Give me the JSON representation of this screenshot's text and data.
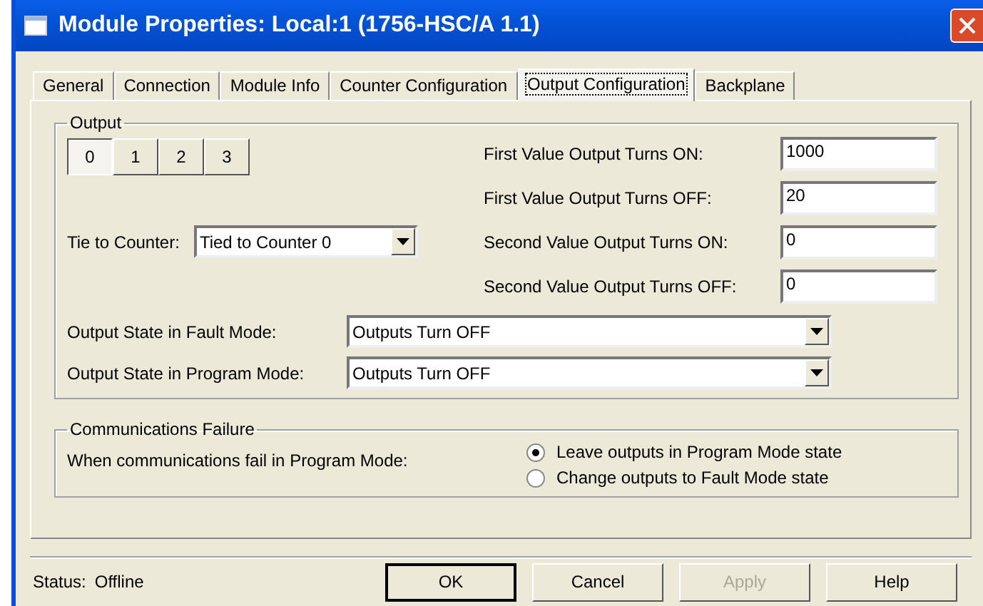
{
  "window": {
    "title": "Module Properties: Local:1 (1756-HSC/A 1.1)"
  },
  "tabs": [
    {
      "label": "General",
      "selected": false
    },
    {
      "label": "Connection",
      "selected": false
    },
    {
      "label": "Module Info",
      "selected": false
    },
    {
      "label": "Counter Configuration",
      "selected": false
    },
    {
      "label": "Output Configuration",
      "selected": true
    },
    {
      "label": "Backplane",
      "selected": false
    }
  ],
  "output": {
    "title": "Output",
    "outputs": [
      {
        "label": "0",
        "selected": true
      },
      {
        "label": "1",
        "selected": false
      },
      {
        "label": "2",
        "selected": false
      },
      {
        "label": "3",
        "selected": false
      }
    ],
    "tie_to_counter": {
      "label": "Tie to Counter:",
      "value": "Tied to Counter 0"
    },
    "values": [
      {
        "label": "First Value Output Turns ON:",
        "value": "1000"
      },
      {
        "label": "First Value Output Turns OFF:",
        "value": "20"
      },
      {
        "label": "Second Value Output Turns ON:",
        "value": "0"
      },
      {
        "label": "Second Value Output Turns OFF:",
        "value": "0"
      }
    ],
    "modes": [
      {
        "label": "Output State in Fault Mode:",
        "value": "Outputs Turn OFF"
      },
      {
        "label": "Output State in Program Mode:",
        "value": "Outputs Turn OFF"
      }
    ]
  },
  "communications": {
    "title": "Communications Failure",
    "prompt": "When communications fail in Program Mode:",
    "options": [
      {
        "label": "Leave outputs in Program Mode state",
        "selected": true
      },
      {
        "label": "Change outputs to Fault Mode state",
        "selected": false
      }
    ]
  },
  "status": {
    "label": "Status:",
    "value": "Offline"
  },
  "buttons": [
    {
      "label": "OK",
      "default": true,
      "disabled": false
    },
    {
      "label": "Cancel",
      "default": false,
      "disabled": false
    },
    {
      "label": "Apply",
      "default": false,
      "disabled": true
    },
    {
      "label": "Help",
      "default": false,
      "disabled": false
    }
  ]
}
